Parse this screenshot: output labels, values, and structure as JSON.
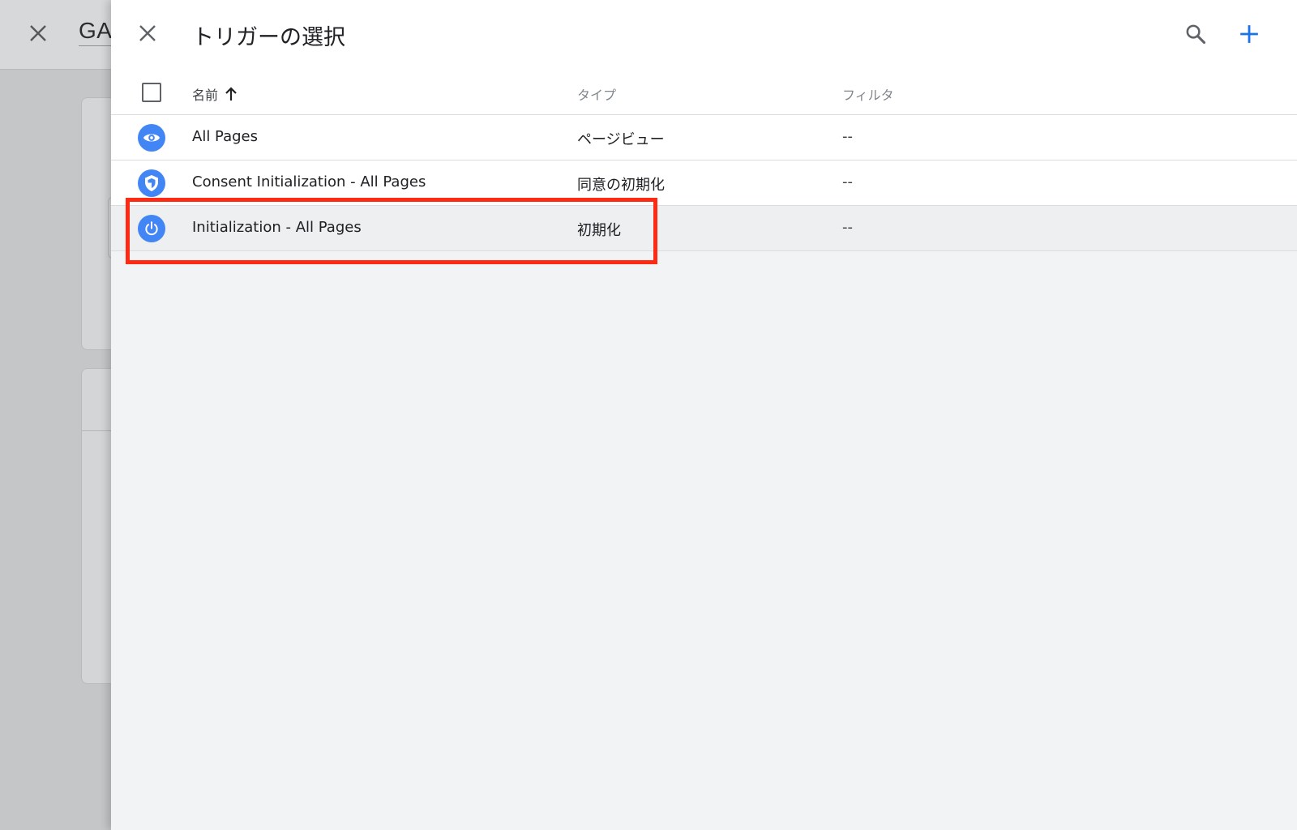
{
  "background": {
    "title": "GA"
  },
  "panel": {
    "title": "トリガーの選択"
  },
  "table": {
    "columns": {
      "name": "名前",
      "type": "タイプ",
      "filter": "フィルタ"
    },
    "rows": [
      {
        "name": "All Pages",
        "type": "ページビュー",
        "filter": "--",
        "icon": "eye-icon"
      },
      {
        "name": "Consent Initialization - All Pages",
        "type": "同意の初期化",
        "filter": "--",
        "icon": "shield-icon"
      },
      {
        "name": "Initialization - All Pages",
        "type": "初期化",
        "filter": "--",
        "icon": "power-icon"
      }
    ],
    "highlighted_row": 2
  },
  "colors": {
    "accent": "#4285f4",
    "highlight": "#ff2a14"
  }
}
